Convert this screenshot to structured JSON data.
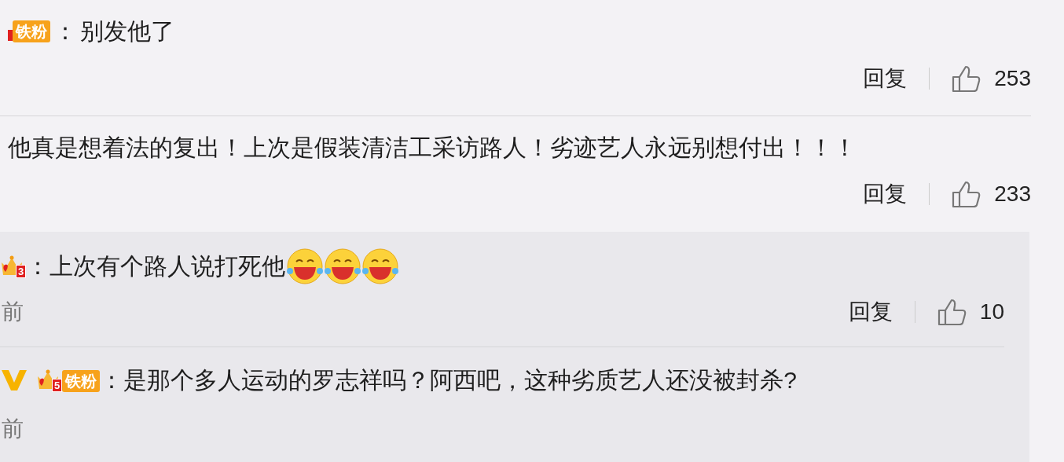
{
  "comments": [
    {
      "badges": [
        {
          "kind": "fan",
          "label": "铁粉"
        }
      ],
      "colon": "：",
      "text": "别发他了",
      "reply": "回复",
      "likes": "253"
    },
    {
      "text": "他真是想着法的复出！上次是假装清洁工采访路人！劣迹艺人永远别想付出！！！",
      "reply": "回复",
      "likes": "233"
    }
  ],
  "replies": [
    {
      "verified": false,
      "badges": [
        {
          "kind": "crown",
          "level": "3"
        }
      ],
      "colon": "：",
      "text": "上次有个路人说打死他",
      "emojis": [
        {
          "kind": "laughing"
        },
        {
          "kind": "laughing"
        },
        {
          "kind": "laughing"
        }
      ],
      "time": "前",
      "reply": "回复",
      "likes": "10"
    },
    {
      "verified": true,
      "badges": [
        {
          "kind": "crown",
          "level": "5",
          "label": "铁粉"
        }
      ],
      "colon": "：",
      "text": "是那个多人运动的罗志祥吗？阿西吧，这种劣质艺人还没被封杀?",
      "time": "前"
    }
  ]
}
